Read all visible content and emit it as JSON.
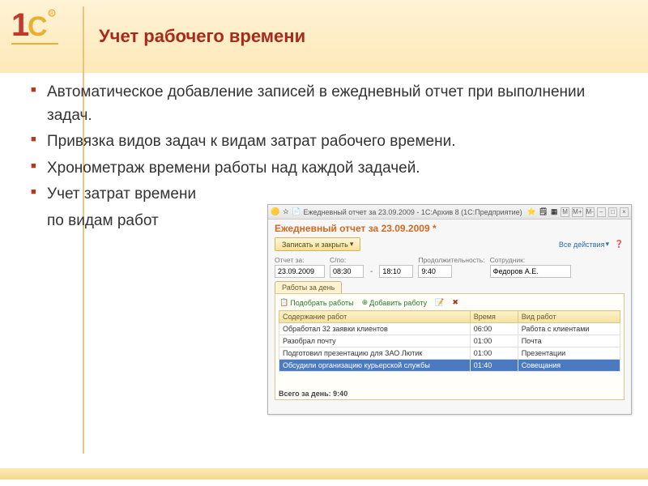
{
  "page": {
    "title": "Учет рабочего времени",
    "bullets": [
      "Автоматическое добавление записей в ежедневный отчет при выполнении задач.",
      "Привязка видов задач к видам затрат рабочего  времени.",
      "Хронометраж времени работы над каждой задачей.",
      "Учет затрат времени"
    ],
    "cont": "по видам работ"
  },
  "window": {
    "titlebar": "Ежедневный отчет за 23.09.2009 - 1С:Архив 8   (1С:Предприятие)",
    "m_buttons": [
      "M",
      "M+",
      "M-"
    ],
    "doc_title": "Ежедневный отчет за 23.09.2009 *",
    "save_label": "Записать и закрыть",
    "all_actions": "Все действия",
    "fields": {
      "date_label": "Отчет за:",
      "date_value": "23.09.2009",
      "from_label": "С/по:",
      "from_value": "08:30",
      "to_value": "18:10",
      "dur_label": "Продолжительность:",
      "dur_value": "9:40",
      "emp_label": "Сотрудник:",
      "emp_value": "Федоров А.Е."
    },
    "tab_label": "Работы за день",
    "actions": {
      "pick": "Подобрать работы",
      "add": "Добавить работу"
    },
    "columns": {
      "c1": "Содержание работ",
      "c2": "Время",
      "c3": "Вид работ"
    },
    "rows": [
      {
        "desc": "Обработал 32 заявки клиентов",
        "time": "06:00",
        "type": "Работа с клиентами"
      },
      {
        "desc": "Разобрал почту",
        "time": "01:00",
        "type": "Почта"
      },
      {
        "desc": "Подготовил презентацию для ЗАО Лютик",
        "time": "01:00",
        "type": "Презентации"
      },
      {
        "desc": "Обсудили организацию курьерской службы",
        "time": "01:40",
        "type": "Совещания"
      }
    ],
    "total": "Всего за день: 9:40"
  }
}
